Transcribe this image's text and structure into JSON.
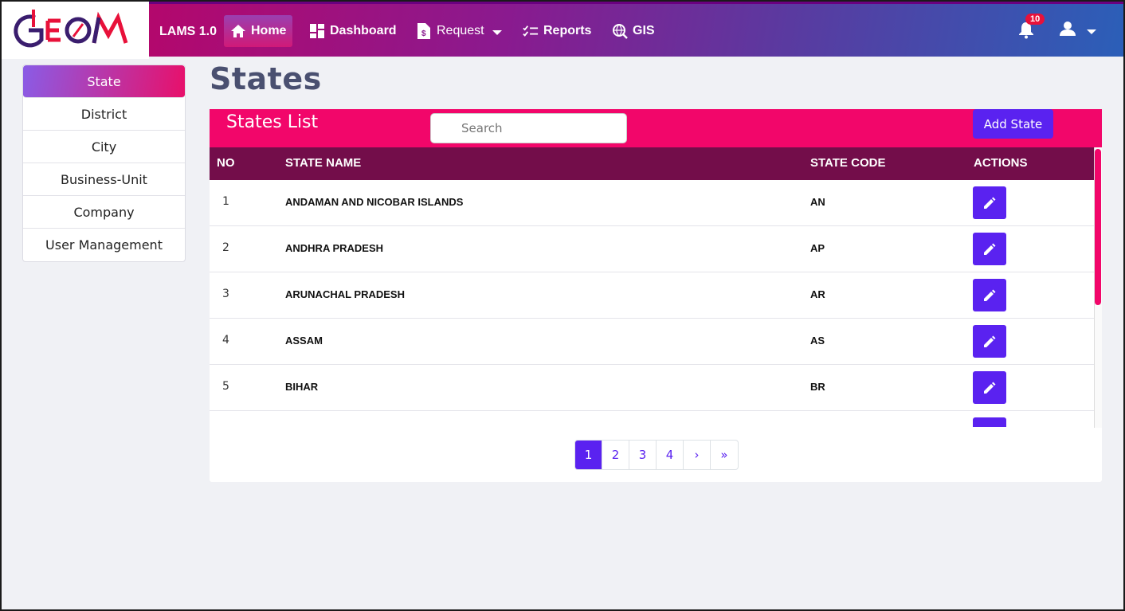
{
  "header": {
    "brand": "LAMS 1.0",
    "nav": [
      {
        "label": "Home",
        "icon": "home-icon",
        "active": true
      },
      {
        "label": "Dashboard",
        "icon": "dashboard-icon"
      },
      {
        "label": "Request",
        "icon": "document-icon",
        "dropdown": true
      },
      {
        "label": "Reports",
        "icon": "checklist-icon"
      },
      {
        "label": "GIS",
        "icon": "globe-search-icon"
      }
    ],
    "notifications_count": "10"
  },
  "sidebar": {
    "items": [
      {
        "label": "State",
        "active": true
      },
      {
        "label": "District"
      },
      {
        "label": "City"
      },
      {
        "label": "Business-Unit"
      },
      {
        "label": "Company"
      },
      {
        "label": "User Management"
      }
    ]
  },
  "main": {
    "page_title": "States",
    "card_title": "States List",
    "search_placeholder": "Search",
    "add_button": "Add State",
    "columns": {
      "no": "NO",
      "name": "STATE NAME",
      "code": "STATE CODE",
      "actions": "ACTIONS"
    },
    "rows": [
      {
        "no": "1",
        "name": "ANDAMAN AND NICOBAR ISLANDS",
        "code": "AN"
      },
      {
        "no": "2",
        "name": "ANDHRA PRADESH",
        "code": "AP"
      },
      {
        "no": "3",
        "name": "ARUNACHAL PRADESH",
        "code": "AR"
      },
      {
        "no": "4",
        "name": "ASSAM",
        "code": "AS"
      },
      {
        "no": "5",
        "name": "BIHAR",
        "code": "BR"
      },
      {
        "no": "",
        "name": "",
        "code": ""
      }
    ],
    "pagination": [
      "1",
      "2",
      "3",
      "4",
      "›",
      "»"
    ],
    "active_page": "1"
  },
  "colors": {
    "accent": "#5a22f0",
    "header_pink": "#f2066a",
    "table_head": "#730d4a"
  }
}
